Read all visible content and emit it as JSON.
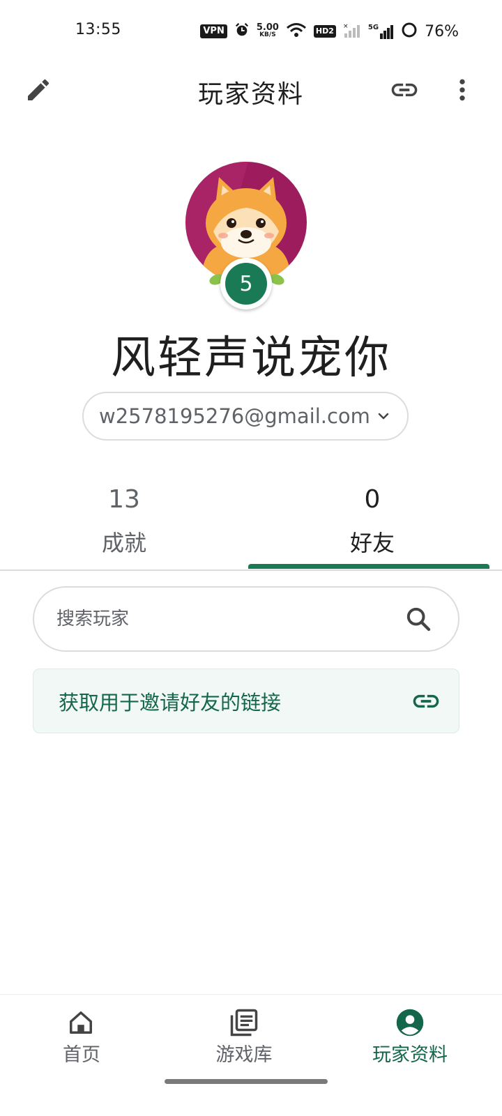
{
  "status_bar": {
    "time": "13:55",
    "vpn": "VPN",
    "net_speed_value": "5.00",
    "net_speed_unit": "KB/S",
    "hd": "HD2",
    "signal_label": "5G",
    "battery": "76%"
  },
  "app_bar": {
    "title": "玩家资料",
    "icons": [
      "edit-icon",
      "link-icon",
      "more-vert-icon"
    ]
  },
  "profile": {
    "level": "5",
    "name": "风轻声说宠你",
    "account_email": "w2578195276@gmail.com"
  },
  "stats_tabs": [
    {
      "count": "13",
      "label": "成就",
      "selected": false
    },
    {
      "count": "0",
      "label": "好友",
      "selected": true
    }
  ],
  "search": {
    "placeholder": "搜索玩家"
  },
  "invite": {
    "label": "获取用于邀请好友的链接"
  },
  "bottom_nav": {
    "items": [
      {
        "label": "首页",
        "icon": "home-icon"
      },
      {
        "label": "游戏库",
        "icon": "library-icon"
      },
      {
        "label": "玩家资料",
        "icon": "account-circle-icon",
        "active": true
      }
    ]
  },
  "colors": {
    "accent": "#1a7a55",
    "accent_text": "#14674a",
    "avatar_bg": "#9c1c5e"
  }
}
